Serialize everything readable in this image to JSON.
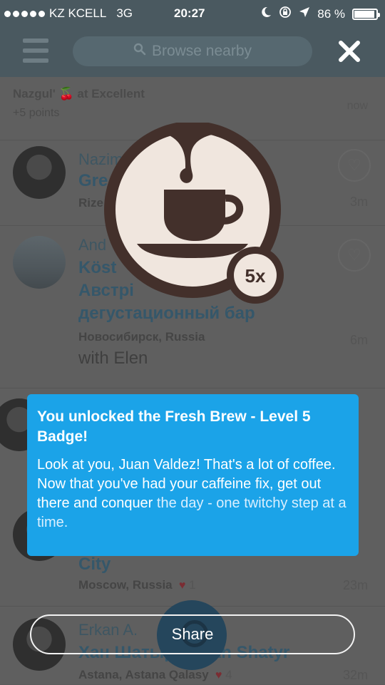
{
  "status_bar": {
    "carrier": "KZ KCELL",
    "network": "3G",
    "time": "20:27",
    "battery": "86 %",
    "icons": [
      "moon-icon",
      "rotation-lock-icon",
      "location-arrow-icon",
      "battery-icon"
    ]
  },
  "header": {
    "search_placeholder": "Browse nearby",
    "icons": [
      "menu-icon",
      "search-icon",
      "close-icon"
    ]
  },
  "feed": {
    "activity": {
      "text": "Nazgul' 🍒 at Excellent",
      "points": "+5 points",
      "time": "now"
    },
    "items": [
      {
        "user": "Nazim",
        "venue": "Gre",
        "location": "Rize",
        "distance": "3m"
      },
      {
        "user": "And",
        "venue_lines": [
          "Köst",
          "Австрі",
          "дегустационный бар"
        ],
        "location": "Новосибирск, Russia",
        "with": "with Elen",
        "distance": "6m"
      },
      {
        "venue": "City",
        "location": "Moscow, Russia",
        "likes": "1",
        "distance": "23m"
      },
      {
        "user": "Erkan A.",
        "venue": "Хан Шатыр / Khan Shatyr",
        "location": "Astana, Astana Qalasy",
        "likes": "4",
        "distance": "32m"
      }
    ]
  },
  "badge": {
    "multiplier": "5x",
    "colors": {
      "ring": "#43302b",
      "inner": "#f0e6de",
      "cup": "#43302b"
    }
  },
  "popup": {
    "title": "You unlocked the Fresh Brew - Level 5 Badge!",
    "body": "Look at you, Juan Valdez! That's a lot of coffee. Now that you've had your caffeine fix, get out there and conquer",
    "body_faded": "the day - one twitchy step at a time.",
    "color": "#1ba3e8"
  },
  "share_button": {
    "label": "Share"
  }
}
